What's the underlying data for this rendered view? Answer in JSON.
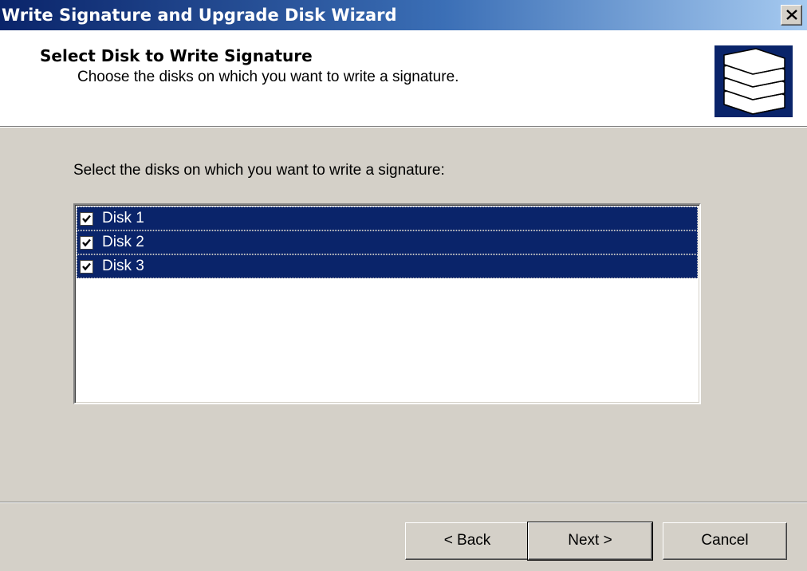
{
  "window": {
    "title": "Write Signature and Upgrade Disk Wizard",
    "close_icon": "close-icon"
  },
  "header": {
    "title": "Select Disk to Write Signature",
    "subtitle": "Choose the disks on which you want to write a signature.",
    "icon": "disk-stack-icon"
  },
  "content": {
    "prompt": "Select the disks on which you want to write a signature:",
    "disks": [
      {
        "label": "Disk 1",
        "checked": true,
        "selected": true
      },
      {
        "label": "Disk 2",
        "checked": true,
        "selected": true
      },
      {
        "label": "Disk 3",
        "checked": true,
        "selected": true
      }
    ]
  },
  "buttons": {
    "back": "< Back",
    "next": "Next >",
    "cancel": "Cancel"
  },
  "colors": {
    "selection": "#0a246a",
    "dialog_bg": "#d4d0c8"
  }
}
